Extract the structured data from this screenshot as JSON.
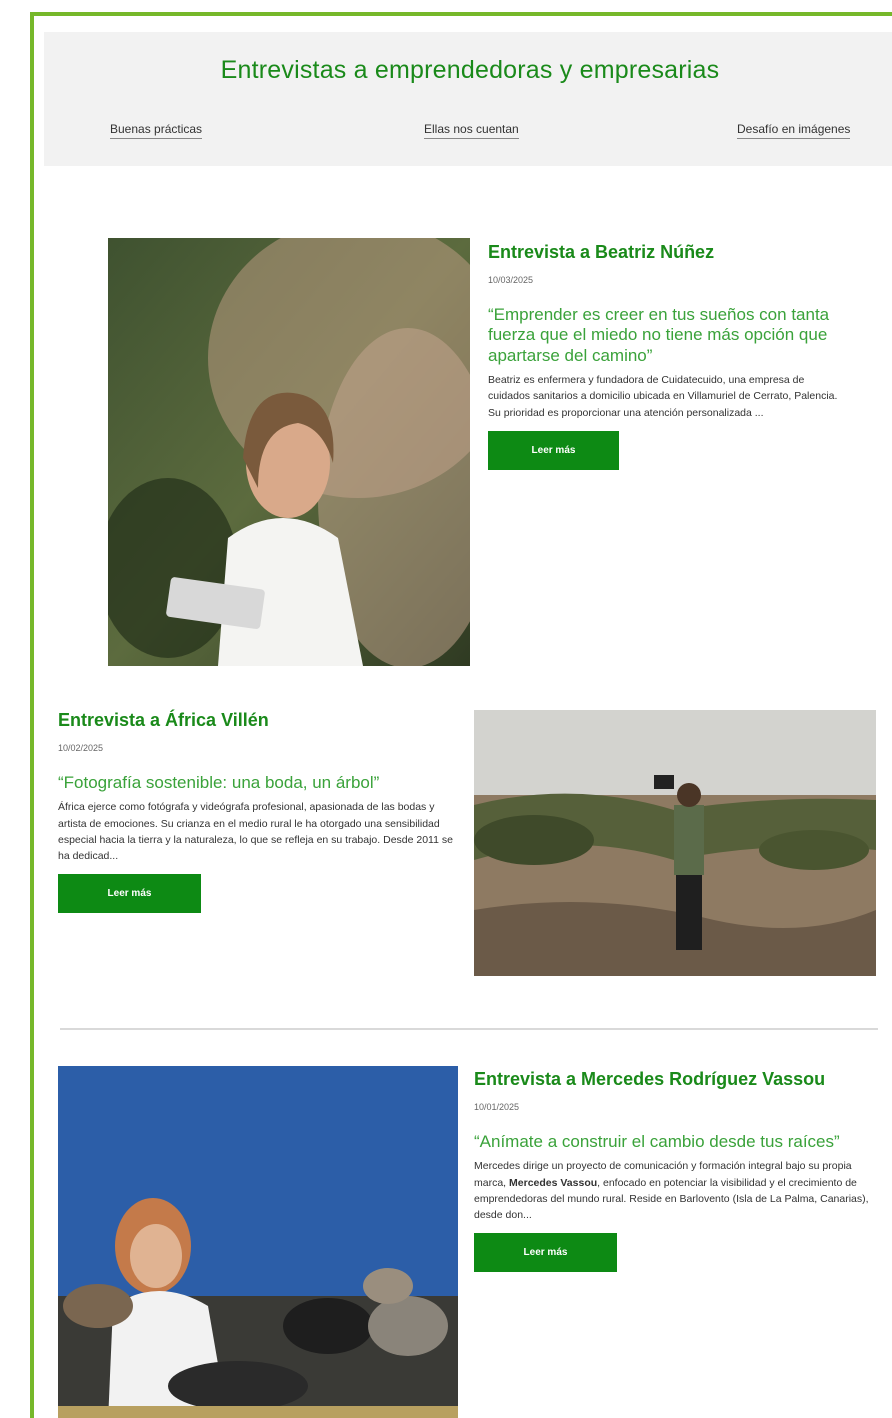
{
  "header": {
    "title": "Entrevistas a emprendedoras y empresarias",
    "tabs": [
      "Buenas prácticas",
      "Ellas nos cuentan",
      "Desafío en imágenes"
    ]
  },
  "articles": [
    {
      "title": "Entrevista a Beatriz Núñez",
      "date": "10/03/2025",
      "quote": "“Emprender es creer en tus sueños con tanta fuerza que el miedo no tiene más opción que apartarse del camino”",
      "excerpt": " Beatriz es enfermera y fundadora de Cuidatecuido, una empresa de cuidados sanitarios a domicilio ubicada en Villamuriel de Cerrato, Palencia. Su prioridad es proporcionar una atención personalizada ...",
      "button": "Leer más"
    },
    {
      "title": "Entrevista a África Villén",
      "date": "10/02/2025",
      "quote": "“Fotografía sostenible: una boda, un árbol”",
      "excerpt": " África ejerce como fotógrafa y videógrafa profesional, apasionada de las bodas y artista de emociones. Su crianza en el medio rural le ha otorgado una sensibilidad especial hacia la tierra y la naturaleza, lo que se refleja en su trabajo. Desde 2011 se ha dedicad...",
      "button": "Leer más"
    },
    {
      "title": "Entrevista a Mercedes Rodríguez Vassou",
      "date": "10/01/2025",
      "quote": "“Anímate a construir el cambio desde tus raíces”",
      "excerpt_before": "Mercedes dirige un proyecto de comunicación y formación integral bajo su propia marca, ",
      "excerpt_bold": "Mercedes Vassou",
      "excerpt_after": ", enfocado en potenciar la visibilidad y el crecimiento de emprendedoras del mundo rural. Reside en Barlovento (Isla de La Palma, Canarias), desde don...",
      "button": "Leer más"
    }
  ],
  "colors": {
    "frame_border": "#76b82a",
    "title_green": "#1a8a1a",
    "quote_green": "#3aa23a",
    "button_green": "#0d8a14",
    "header_bg": "#f2f2f2"
  }
}
